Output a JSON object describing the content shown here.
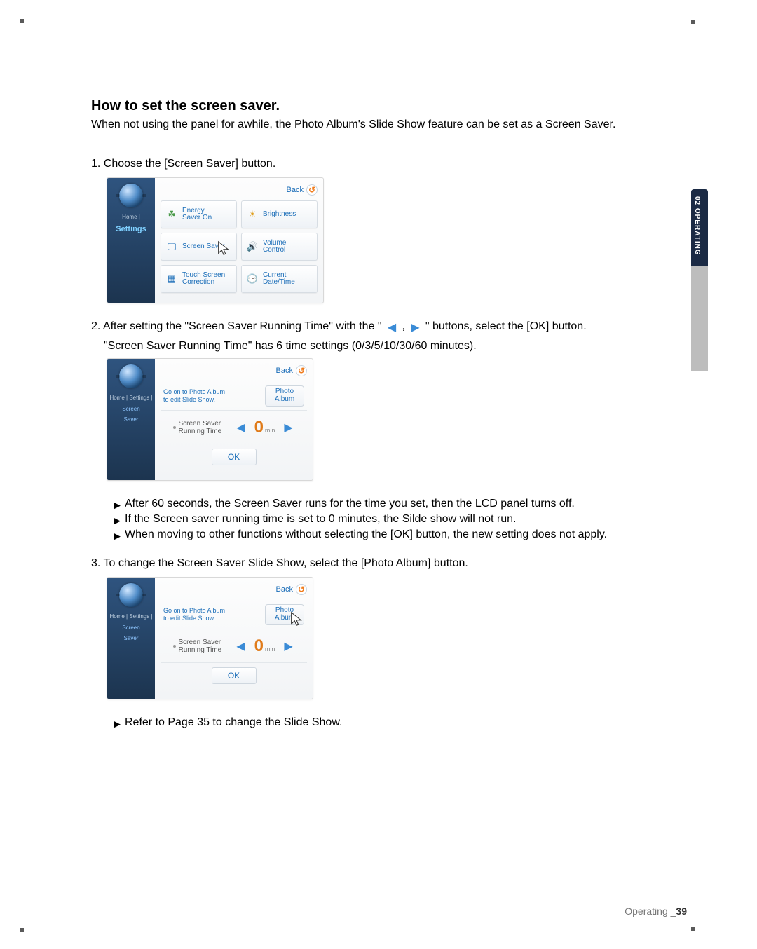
{
  "side_tab": "02 OPERATING",
  "heading": "How to set the screen saver.",
  "intro": "When not using the panel for awhile,  the Photo Album's Slide Show feature can be set as a Screen Saver.",
  "step1": "1. Choose the [Screen Saver] button.",
  "settings_panel": {
    "back": "Back",
    "breadcrumb_top": "Home |",
    "breadcrumb_hl": "Settings",
    "tiles": {
      "energy": "Energy\nSaver On",
      "brightness": "Brightness",
      "screen_saver": "Screen Saver",
      "volume": "Volume\nControl",
      "touch": "Touch Screen\nCorrection",
      "datetime": "Current\nDate/Time"
    }
  },
  "step2_line1_a": "2. After setting the \"Screen Saver Running Time\" with the \" ",
  "step2_line1_b": " , ",
  "step2_line1_c": " \" buttons, select the [OK] button.",
  "step2_line2": "\"Screen Saver Running Time\" has 6 time settings (0/3/5/10/30/60 minutes).",
  "saver_panel": {
    "back": "Back",
    "breadcrumb_top": "Home | Settings |",
    "breadcrumb_hl1": "Screen",
    "breadcrumb_hl2": "Saver",
    "row1_desc": "Go on to Photo Album\nto edit Slide Show.",
    "row1_btn_a": "Photo\nAlbum",
    "row1_btn_b": "Photo\nAlbum",
    "time_label": "Screen Saver\nRunning Time",
    "time_value": "0",
    "time_unit": "min",
    "ok": "OK"
  },
  "bullets_a": [
    "After 60 seconds, the Screen Saver runs for the time you set, then the LCD panel turns off.",
    "If the Screen saver running time is set to 0 minutes, the Silde show will not run.",
    "When moving to other functions without selecting the [OK] button, the new setting does not apply."
  ],
  "step3": "3. To change the Screen Saver Slide Show, select the [Photo Album] button.",
  "bullets_b": [
    "Refer to Page 35 to change the Slide Show."
  ],
  "footer_label": "Operating _",
  "footer_num": "39"
}
